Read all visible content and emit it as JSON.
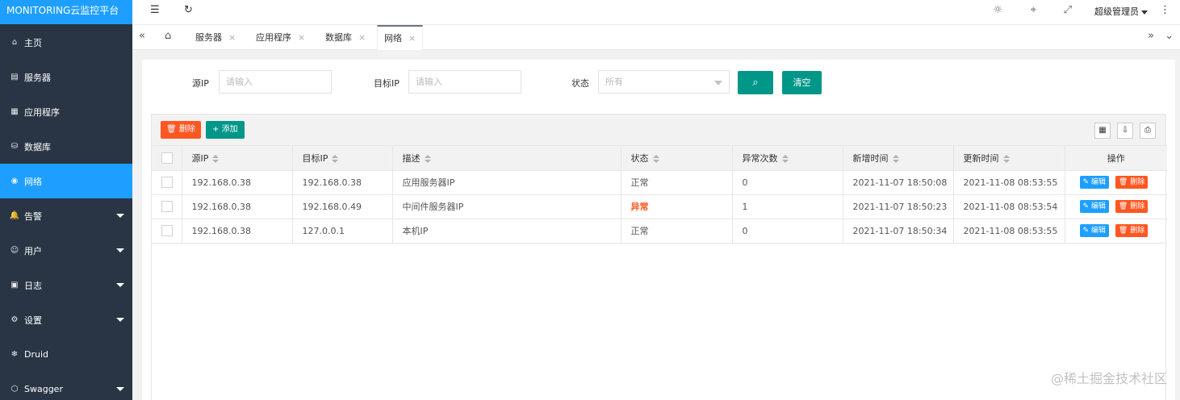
{
  "brand": "MONITORING云监控平台",
  "sidebar": {
    "items": [
      {
        "icon": "⌂",
        "label": "主页"
      },
      {
        "icon": "▤",
        "label": "服务器"
      },
      {
        "icon": "▦",
        "label": "应用程序"
      },
      {
        "icon": "⛁",
        "label": "数据库"
      },
      {
        "icon": "◉",
        "label": "网络"
      },
      {
        "icon": "🔔",
        "label": "告警"
      },
      {
        "icon": "☺",
        "label": "用户"
      },
      {
        "icon": "▣",
        "label": "日志"
      },
      {
        "icon": "⚙",
        "label": "设置"
      },
      {
        "icon": "❄",
        "label": "Druid"
      },
      {
        "icon": "⬡",
        "label": "Swagger"
      }
    ]
  },
  "header": {
    "menu_icon": "☰",
    "refresh_icon": "↻",
    "user": "超级管理员",
    "more_icon": "⋮",
    "palette_icon": "☼",
    "tag_icon": "⌖",
    "fullscreen_icon": "⤢"
  },
  "tabs": {
    "prev_icon": "«",
    "home_icon": "⌂",
    "items": [
      "服务器",
      "应用程序",
      "数据库",
      "网络"
    ],
    "close": "×",
    "next_icon": "»",
    "dropdown_icon": "⌄"
  },
  "filters": {
    "source_ip_label": "源IP",
    "source_ip_placeholder": "请输入",
    "target_ip_label": "目标IP",
    "target_ip_placeholder": "请输入",
    "status_label": "状态",
    "status_value": "所有",
    "search_icon": "⌕",
    "clear_label": "清空"
  },
  "toolbar": {
    "delete_label": "删除",
    "delete_icon": "🗑",
    "add_label": "添加",
    "add_icon": "+",
    "columns_icon": "▦",
    "export_icon": "⇩",
    "print_icon": "⎙"
  },
  "table": {
    "headers": [
      "源IP",
      "目标IP",
      "描述",
      "状态",
      "异常次数",
      "新增时间",
      "更新时间",
      "操作"
    ],
    "rows": [
      {
        "src": "192.168.0.38",
        "dst": "192.168.0.38",
        "desc": "应用服务器IP",
        "status": "正常",
        "count": "0",
        "created": "2021-11-07 18:50:08",
        "updated": "2021-11-08 08:53:55"
      },
      {
        "src": "192.168.0.38",
        "dst": "192.168.0.49",
        "desc": "中间件服务器IP",
        "status": "异常",
        "count": "1",
        "created": "2021-11-07 18:50:23",
        "updated": "2021-11-08 08:53:54"
      },
      {
        "src": "192.168.0.38",
        "dst": "127.0.0.1",
        "desc": "本机IP",
        "status": "正常",
        "count": "0",
        "created": "2021-11-07 18:50:34",
        "updated": "2021-11-08 08:53:55"
      }
    ],
    "edit_label": "✎ 编辑",
    "delete_label": "🗑 删除"
  },
  "watermark": "@稀土掘金技术社区",
  "colors": {
    "sidebar_bg": "#293545",
    "accent_blue": "#1e9fff",
    "teal": "#009688",
    "danger": "#ff5722"
  }
}
